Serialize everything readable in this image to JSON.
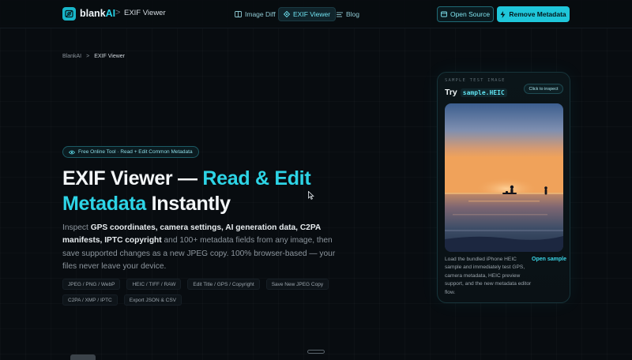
{
  "header": {
    "logo_main": "blank",
    "logo_accent": "AI",
    "separator": ">",
    "current": "EXIF Viewer",
    "nav": [
      {
        "label": "Image Diff",
        "icon": "columns-icon"
      },
      {
        "label": "EXIF Viewer",
        "icon": "diamond-icon"
      },
      {
        "label": "Blog",
        "icon": "list-icon"
      }
    ],
    "open_source_label": "Open Source",
    "remove_metadata_label": "Remove Metadata"
  },
  "breadcrumb": {
    "root": "BlankAI",
    "sep": ">",
    "current": "EXIF Viewer"
  },
  "hero": {
    "badge": "Free Online Tool · Read + Edit Common Metadata",
    "title_plain_1": "EXIF Viewer — ",
    "title_accent_1": "Read & Edit",
    "title_accent_2": "Metadata",
    "title_plain_2": " Instantly",
    "lede": {
      "t1": "Inspect ",
      "b1": "GPS coordinates, camera settings, AI generation data, C2PA manifests, IPTC copyright",
      "t2": " and 100+ metadata fields from any image, then save supported changes as a new JPEG copy. 100% browser-based — your files never leave your device."
    },
    "chips": [
      "JPEG / PNG / WebP",
      "HEIC / TIFF / RAW",
      "Edit Title / GPS / Copyright",
      "Save New JPEG Copy",
      "C2PA / XMP / IPTC",
      "Export JSON & CSV"
    ]
  },
  "sample_card": {
    "eyebrow": "SAMPLE TEST IMAGE",
    "try_label": "Try",
    "file_name": "sample.HEIC",
    "inspect_label": "Click to inspect",
    "description": "Load the bundled iPhone HEIC sample and immediately test GPS, camera metadata, HEIC preview support, and the new metadata editor flow.",
    "open_label": "Open sample"
  },
  "bottom": {
    "partial_text": "sample.HEIC"
  },
  "colors": {
    "accent": "#1fc6da",
    "background": "#080c10"
  }
}
